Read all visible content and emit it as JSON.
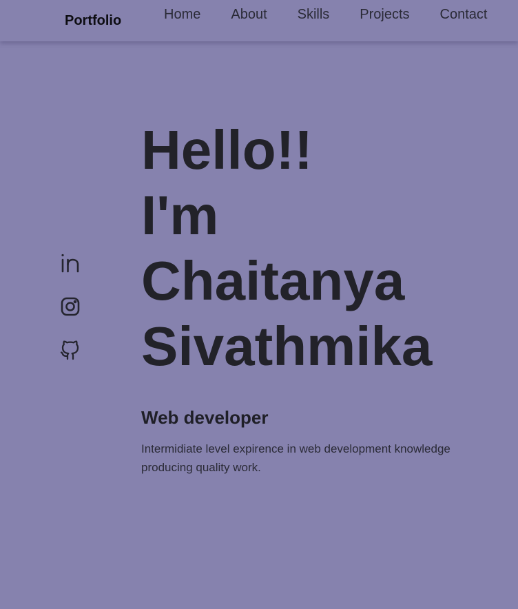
{
  "header": {
    "logo": "Portfolio",
    "nav": [
      {
        "label": "Home"
      },
      {
        "label": "About"
      },
      {
        "label": "Skills"
      },
      {
        "label": "Projects"
      },
      {
        "label": "Contact"
      }
    ]
  },
  "socials": [
    {
      "icon": "linkedin-icon"
    },
    {
      "icon": "instagram-icon"
    },
    {
      "icon": "github-icon"
    }
  ],
  "hero": {
    "line1": "Hello!!",
    "line2": "I'm",
    "line3": "Chaitanya",
    "line4": "Sivathmika",
    "subtitle": "Web developer",
    "description": "Intermidiate level expirence in web development knowledge producing quality work."
  },
  "colors": {
    "background": "#8682ae",
    "text": "#222229"
  }
}
